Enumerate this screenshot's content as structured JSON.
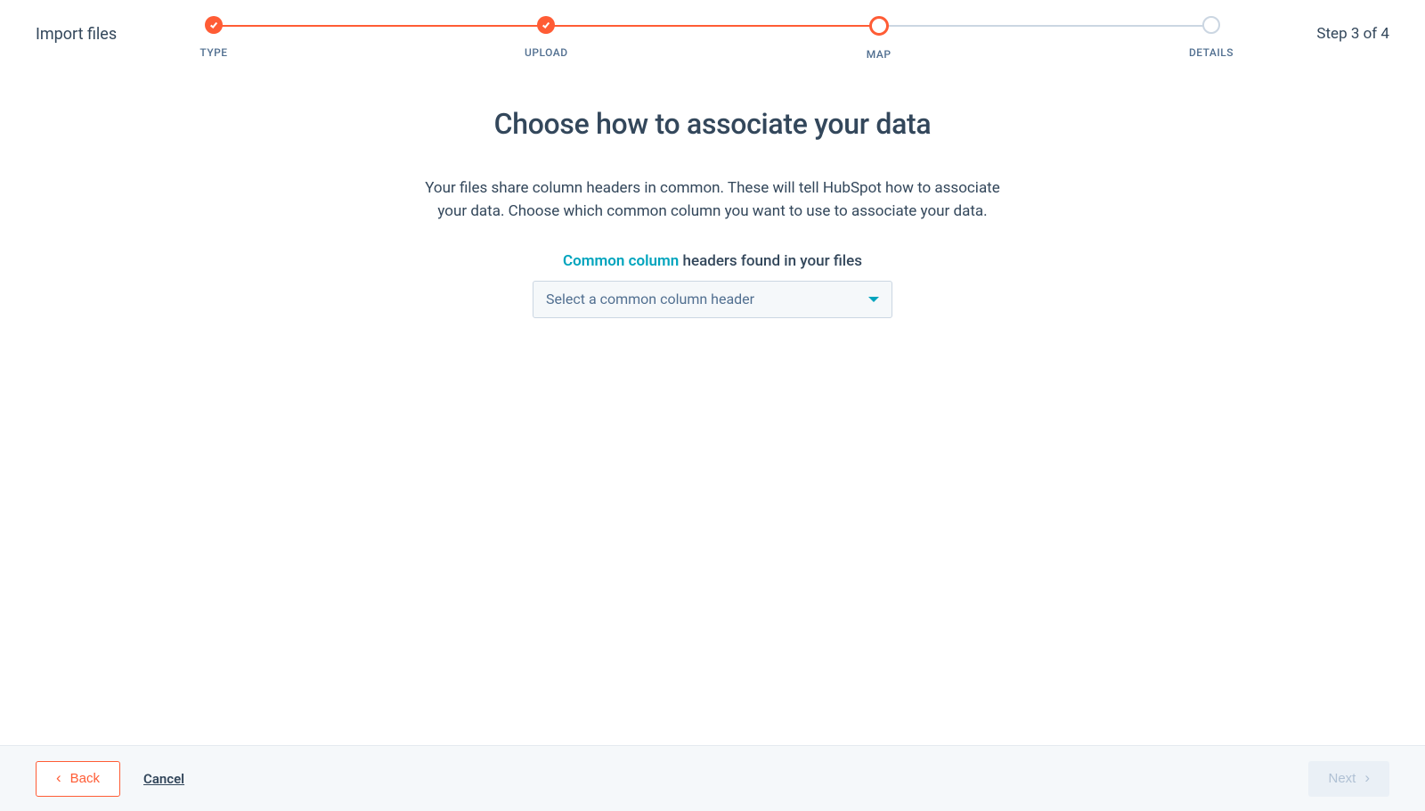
{
  "header": {
    "title": "Import files",
    "step_indicator": "Step 3 of 4"
  },
  "stepper": {
    "steps": [
      {
        "label": "TYPE",
        "state": "done"
      },
      {
        "label": "UPLOAD",
        "state": "done"
      },
      {
        "label": "MAP",
        "state": "current"
      },
      {
        "label": "DETAILS",
        "state": "pending"
      }
    ]
  },
  "main": {
    "heading": "Choose how to associate your data",
    "description": "Your files share column headers in common. These will tell HubSpot how to associate your data. Choose which common column you want to use to associate your data.",
    "column_label_highlight": "Common column",
    "column_label_rest": " headers found in your files",
    "select_placeholder": "Select a common column header"
  },
  "footer": {
    "back_label": "Back",
    "cancel_label": "Cancel",
    "next_label": "Next"
  }
}
